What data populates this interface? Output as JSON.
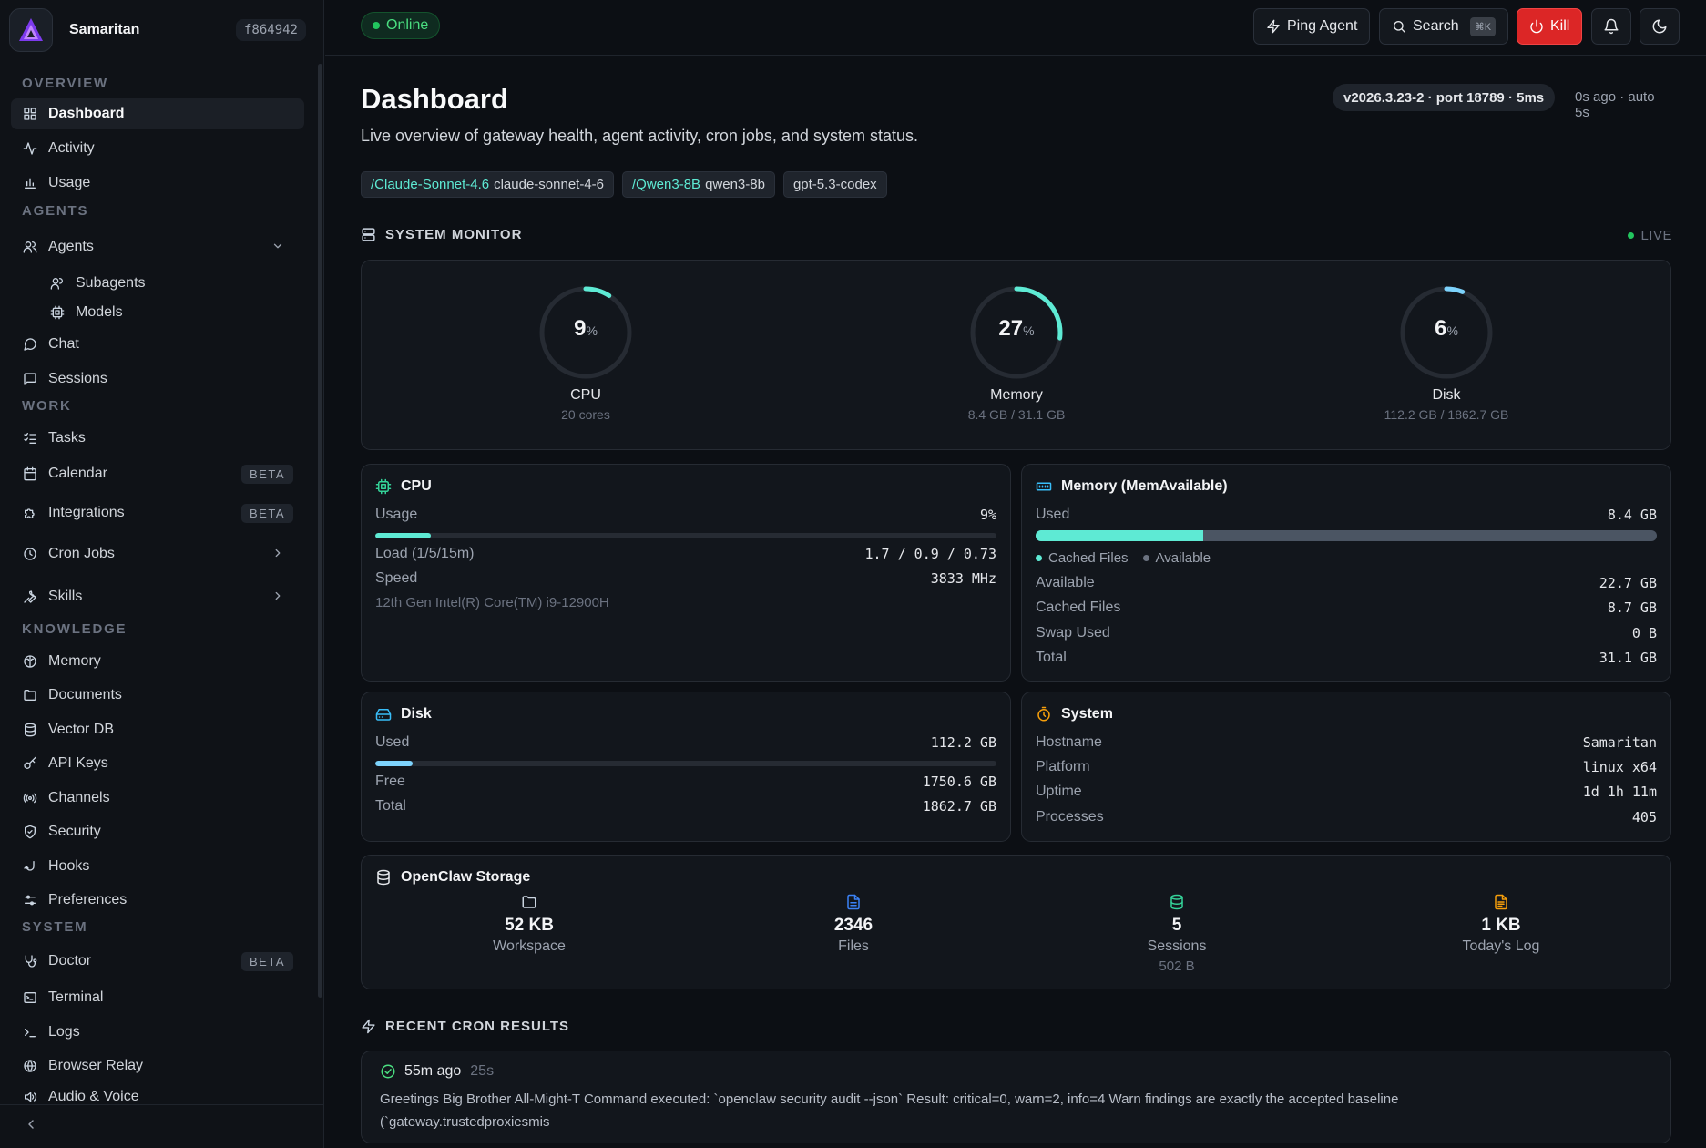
{
  "brand": {
    "name": "Samaritan",
    "hash": "f864942"
  },
  "sidebar": {
    "sections": [
      {
        "key": "overview",
        "label": "OVERVIEW"
      },
      {
        "key": "agents",
        "label": "AGENTS"
      },
      {
        "key": "work",
        "label": "WORK"
      },
      {
        "key": "knowledge",
        "label": "KNOWLEDGE"
      },
      {
        "key": "system",
        "label": "SYSTEM"
      }
    ],
    "items": {
      "dashboard": {
        "label": "Dashboard",
        "icon": "dashboard-icon"
      },
      "activity": {
        "label": "Activity",
        "icon": "activity-icon"
      },
      "usage": {
        "label": "Usage",
        "icon": "bar-chart-icon"
      },
      "agents": {
        "label": "Agents",
        "icon": "users-icon"
      },
      "subagents": {
        "label": "Subagents",
        "icon": "users-icon"
      },
      "models": {
        "label": "Models",
        "icon": "cpu-icon"
      },
      "chat": {
        "label": "Chat",
        "icon": "chat-bubble-icon"
      },
      "sessions": {
        "label": "Sessions",
        "icon": "message-square-icon"
      },
      "tasks": {
        "label": "Tasks",
        "icon": "list-checks-icon"
      },
      "calendar": {
        "label": "Calendar",
        "icon": "calendar-icon",
        "badge": "BETA"
      },
      "integrations": {
        "label": "Integrations",
        "icon": "puzzle-icon",
        "badge": "BETA"
      },
      "cron_jobs": {
        "label": "Cron Jobs",
        "icon": "clock-icon"
      },
      "skills": {
        "label": "Skills",
        "icon": "wrench-icon"
      },
      "memory": {
        "label": "Memory",
        "icon": "brain-icon"
      },
      "documents": {
        "label": "Documents",
        "icon": "folder-icon"
      },
      "vector_db": {
        "label": "Vector DB",
        "icon": "database-icon"
      },
      "api_keys": {
        "label": "API Keys",
        "icon": "key-icon"
      },
      "channels": {
        "label": "Channels",
        "icon": "radio-icon"
      },
      "security": {
        "label": "Security",
        "icon": "shield-icon"
      },
      "hooks": {
        "label": "Hooks",
        "icon": "hook-icon"
      },
      "preferences": {
        "label": "Preferences",
        "icon": "sliders-icon"
      },
      "doctor": {
        "label": "Doctor",
        "icon": "stethoscope-icon",
        "badge": "BETA"
      },
      "terminal": {
        "label": "Terminal",
        "icon": "terminal-icon"
      },
      "logs": {
        "label": "Logs",
        "icon": "prompt-icon"
      },
      "browser_relay": {
        "label": "Browser Relay",
        "icon": "globe-icon"
      },
      "audio_voice": {
        "label": "Audio & Voice",
        "icon": "speaker-icon"
      }
    }
  },
  "topbar": {
    "status": "Online",
    "ping_label": "Ping Agent",
    "search_label": "Search",
    "search_shortcut": "⌘K",
    "kill_label": "Kill"
  },
  "header": {
    "title": "Dashboard",
    "subtitle": "Live overview of gateway health, agent activity, cron jobs, and system status.",
    "version": "v2026.3.23-2 · port 18789 · 5ms",
    "updated": "0s ago · auto 5s"
  },
  "models": [
    {
      "alias": "/Claude-Sonnet-4.6",
      "name": "claude-sonnet-4-6"
    },
    {
      "alias": "/Qwen3-8B",
      "name": "qwen3-8b"
    },
    {
      "alias": "",
      "name": "gpt-5.3-codex"
    }
  ],
  "system_monitor": {
    "title": "SYSTEM MONITOR",
    "live": "LIVE",
    "gauges": [
      {
        "label": "CPU",
        "value": "9",
        "unit": "%",
        "sub": "20 cores",
        "percent": 9,
        "color": "#5eead4"
      },
      {
        "label": "Memory",
        "value": "27",
        "unit": "%",
        "sub": "8.4 GB / 31.1 GB",
        "percent": 27,
        "color": "#5eead4"
      },
      {
        "label": "Disk",
        "value": "6",
        "unit": "%",
        "sub": "112.2 GB / 1862.7 GB",
        "percent": 6,
        "color": "#7dd3fc"
      }
    ]
  },
  "cpu": {
    "title": "CPU",
    "usage_label": "Usage",
    "usage_value": "9%",
    "usage_percent": 9,
    "load_label": "Load (1/5/15m)",
    "load_value": "1.7 / 0.9 / 0.73",
    "speed_label": "Speed",
    "speed_value": "3833 MHz",
    "model": "12th Gen Intel(R) Core(TM) i9-12900H"
  },
  "memory": {
    "title": "Memory (MemAvailable)",
    "used_label": "Used",
    "used_value": "8.4 GB",
    "used_percent": 27,
    "legend_cached": "Cached Files",
    "legend_available": "Available",
    "rows": [
      {
        "label": "Available",
        "value": "22.7 GB"
      },
      {
        "label": "Cached Files",
        "value": "8.7 GB"
      },
      {
        "label": "Swap Used",
        "value": "0 B"
      },
      {
        "label": "Total",
        "value": "31.1 GB"
      }
    ]
  },
  "disk": {
    "title": "Disk",
    "used_label": "Used",
    "used_value": "112.2 GB",
    "used_percent": 6,
    "free_label": "Free",
    "free_value": "1750.6 GB",
    "total_label": "Total",
    "total_value": "1862.7 GB"
  },
  "system": {
    "title": "System",
    "rows": [
      {
        "label": "Hostname",
        "value": "Samaritan"
      },
      {
        "label": "Platform",
        "value": "linux x64"
      },
      {
        "label": "Uptime",
        "value": "1d 1h 11m"
      },
      {
        "label": "Processes",
        "value": "405"
      }
    ]
  },
  "storage": {
    "title": "OpenClaw Storage",
    "items": [
      {
        "value": "52 KB",
        "label": "Workspace",
        "sub": "",
        "icon": "folder-icon"
      },
      {
        "value": "2346",
        "label": "Files",
        "sub": "",
        "icon": "file-icon"
      },
      {
        "value": "5",
        "label": "Sessions",
        "sub": "502 B",
        "icon": "database-icon"
      },
      {
        "value": "1 KB",
        "label": "Today's Log",
        "sub": "",
        "icon": "log-file-icon"
      }
    ]
  },
  "cron": {
    "title": "RECENT CRON RESULTS",
    "results": [
      {
        "time": "55m ago",
        "duration": "25s",
        "text": "Greetings Big Brother All-Might-T Command executed: `openclaw security audit --json` Result: critical=0, warn=2, info=4 Warn findings are exactly the accepted baseline (`gateway.trustedproxiesmis"
      }
    ]
  },
  "colors": {
    "accent": "#5eead4",
    "online": "#22c55e",
    "kill": "#dc2626",
    "disk": "#7dd3fc",
    "storage_file": "#3b82f6",
    "storage_db": "#34d399",
    "storage_log": "#f59e0b",
    "system_icon": "#f59e0b"
  }
}
